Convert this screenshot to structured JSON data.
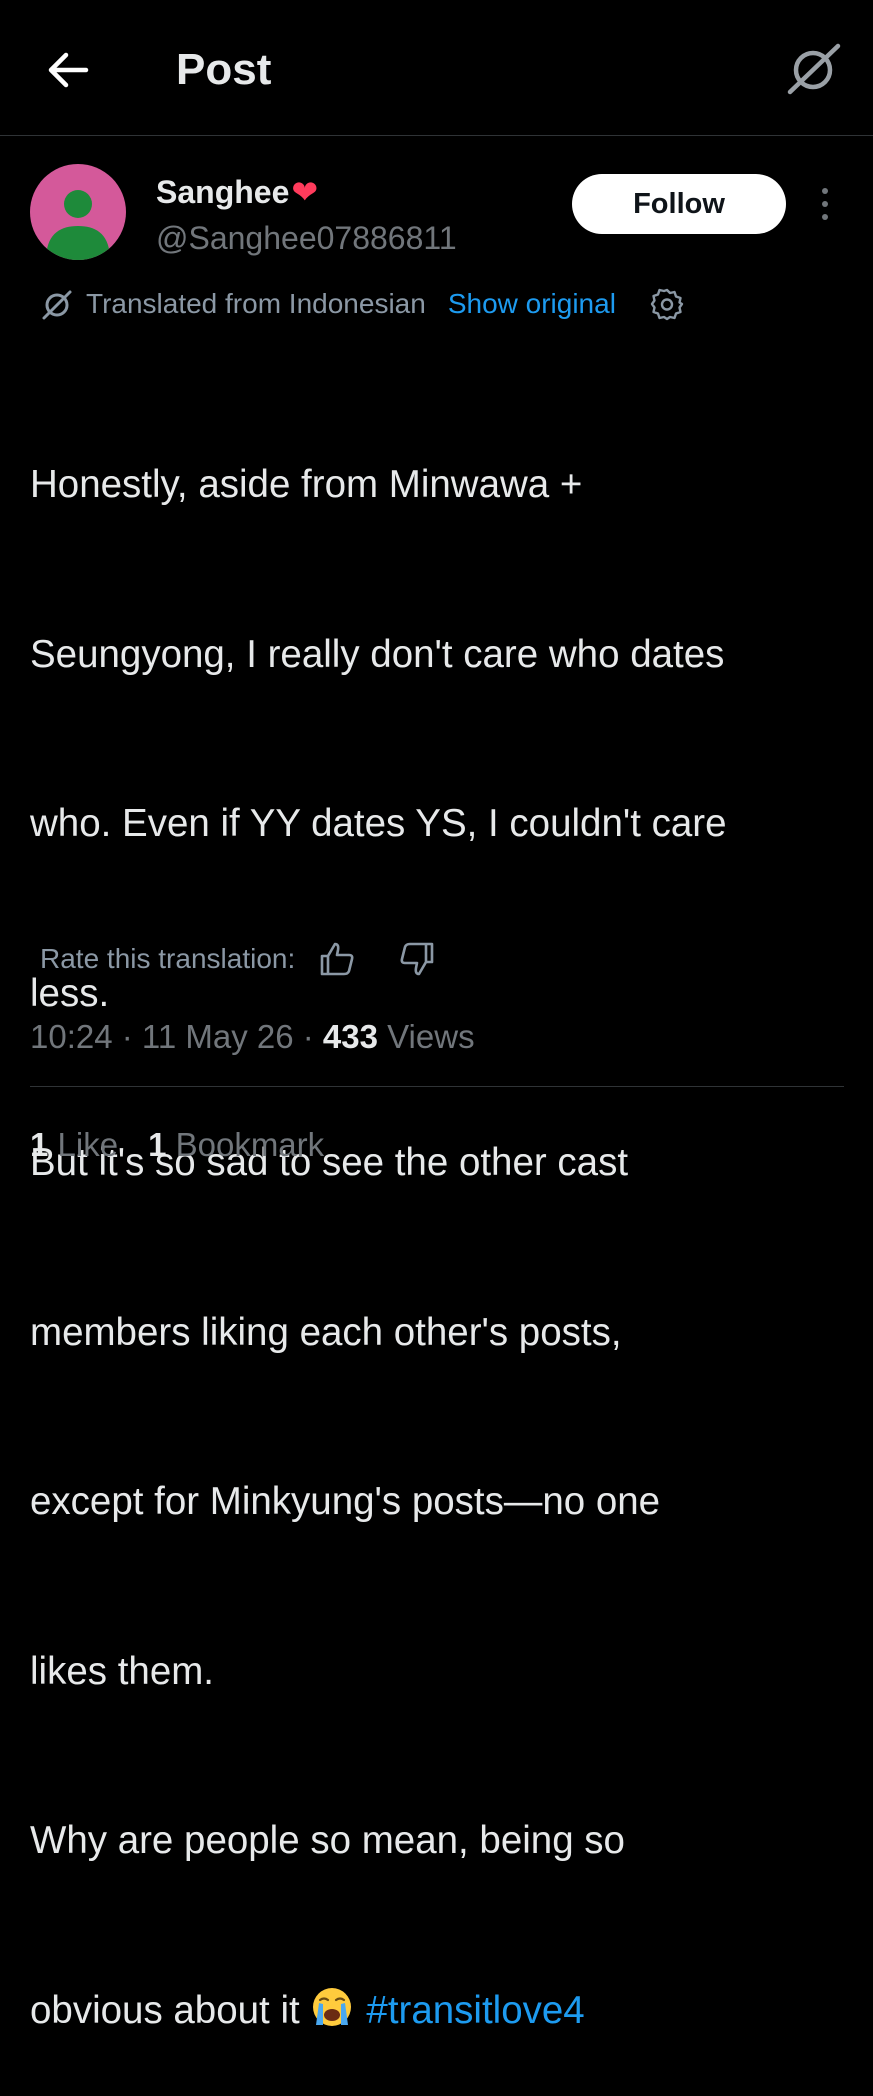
{
  "header": {
    "title": "Post",
    "back_icon": "arrow-left-icon",
    "grok_icon": "grok-icon"
  },
  "author": {
    "display_name": "Sanghee",
    "name_emoji": "❤",
    "handle": "@Sanghee07886811",
    "avatar_color": "#d4599a",
    "avatar_figure_color": "#1e8a3a"
  },
  "follow_button": {
    "label": "Follow"
  },
  "more_icon": "more-vertical-icon",
  "translation": {
    "notice": "Translated from Indonesian",
    "show_original": "Show original",
    "settings_icon": "gear-icon"
  },
  "post": {
    "lines": [
      "Honestly, aside from Minwawa +",
      "Seungyong, I really don't care who dates",
      "who. Even if YY dates YS, I couldn't care",
      "less.",
      "But it's so sad to see the other cast",
      "members liking each other's posts,",
      "except for Minkyung's posts—no one",
      "likes them.",
      "Why are people so mean, being so"
    ],
    "last_line_text": "obvious about it",
    "last_line_emoji": "loudly-crying-face-emoji",
    "hashtag": "#transitlove4"
  },
  "rate": {
    "label": "Rate this translation:",
    "up_icon": "thumbs-up-icon",
    "down_icon": "thumbs-down-icon"
  },
  "meta": {
    "time": "10:24",
    "sep1": " · ",
    "date": "11 May 26",
    "sep2": " · ",
    "views_count": "433",
    "views_label": " Views"
  },
  "stats": {
    "likes_count": "1",
    "likes_label": " Like",
    "bookmarks_count": "1",
    "bookmarks_label": " Bookmark"
  },
  "colors": {
    "background": "#000000",
    "text_primary": "#e7e9ea",
    "text_secondary": "#71767b",
    "accent": "#1d9bf0",
    "divider": "#2f3336"
  }
}
